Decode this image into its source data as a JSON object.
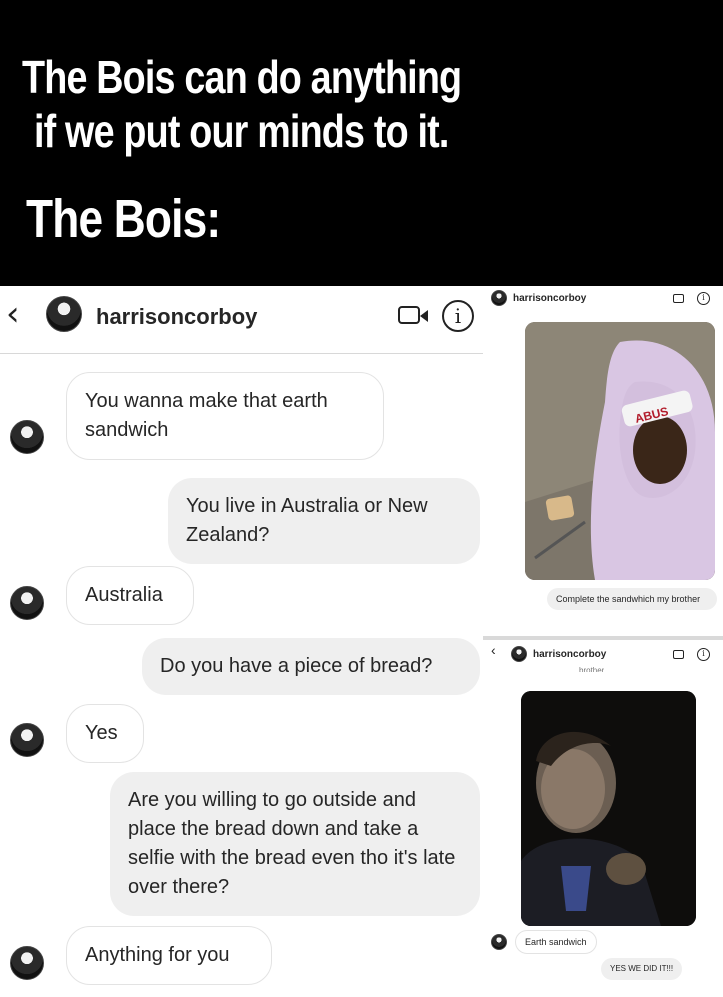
{
  "caption": {
    "line1": "The Bois can do anything",
    "line2": "if we put our minds to it.",
    "line3": "The Bois:"
  },
  "chat": {
    "back_glyph": "‹",
    "username": "harrisoncorboy",
    "video_icon": "video-call-icon",
    "info_icon": "info-icon",
    "info_glyph": "i",
    "messages": [
      {
        "from": "them",
        "text": "You wanna make that earth sandwich"
      },
      {
        "from": "me",
        "text": "You live in Australia or New Zealand?"
      },
      {
        "from": "them",
        "text": "Australia"
      },
      {
        "from": "me",
        "text": "Do you have a piece of bread?"
      },
      {
        "from": "them",
        "text": "Yes"
      },
      {
        "from": "me",
        "text": "Are you willing to go outside and place the bread down and take a selfie with the bread even tho it's late over there?"
      },
      {
        "from": "them",
        "text": "Anything for you"
      }
    ]
  },
  "right_top": {
    "username": "harrisoncorboy",
    "photo_caption": "ABUS",
    "message": "Complete the sandwhich my brother"
  },
  "right_bottom": {
    "back_glyph": "‹",
    "username": "harrisoncorboy",
    "partial_text": "brother",
    "message_them": "Earth sandwich",
    "message_me": "YES WE DID IT!!!"
  },
  "colors": {
    "caption_bg": "#000000",
    "caption_text": "#ffffff",
    "sent_bubble": "#efefef",
    "received_border": "#e3e3e3"
  }
}
